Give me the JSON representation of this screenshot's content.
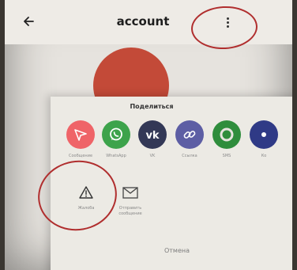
{
  "app_bar": {
    "back_icon": "arrow-left-icon",
    "title": "account",
    "more_icon": "more-vertical-icon"
  },
  "profile": {
    "avatar_color": "#c34a38"
  },
  "share_sheet": {
    "title": "Поделиться",
    "targets": [
      {
        "label": "Сообщение",
        "icon": "send-icon",
        "color": "#ef6468"
      },
      {
        "label": "WhatsApp",
        "icon": "whatsapp-icon",
        "color": "#3da34b"
      },
      {
        "label": "VK",
        "icon": "vk-icon",
        "color": "#333856"
      },
      {
        "label": "Ссылка",
        "icon": "link-icon",
        "color": "#5d5ea4"
      },
      {
        "label": "SMS",
        "icon": "sms-icon",
        "color": "#2f8d3c"
      },
      {
        "label": "Ко",
        "icon": "share-icon",
        "color": "#2f3a86"
      }
    ],
    "actions": [
      {
        "label": "Жалоба",
        "icon": "warning-triangle-icon"
      },
      {
        "label": "Отправить сообщение",
        "icon": "envelope-icon"
      }
    ],
    "cancel_label": "Отмена"
  },
  "annotation_color": "#b02e2e"
}
